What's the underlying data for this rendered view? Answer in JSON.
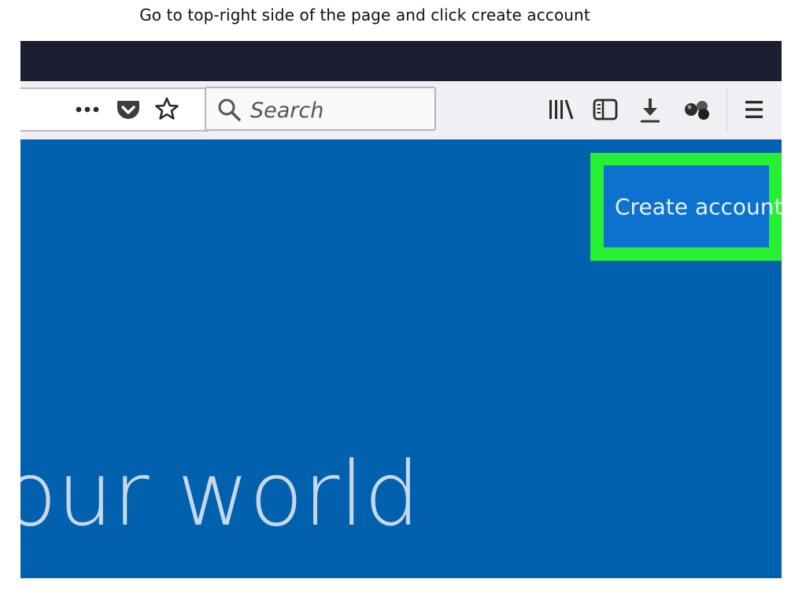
{
  "caption": "Go to top-right side of the page and click create account",
  "toolbar": {
    "search_placeholder": "Search",
    "icons": [
      "more-options-icon",
      "pocket-icon",
      "bookmark-star-icon",
      "search-icon",
      "library-icon",
      "sidebar-icon",
      "download-icon",
      "extension-icon",
      "hamburger-menu-icon"
    ]
  },
  "page": {
    "create_account_label": "Create account",
    "hero_text": "our world",
    "colors": {
      "page_bg": "#0161ae",
      "highlight": "#27f033",
      "button_bg": "#0d72cf"
    }
  }
}
